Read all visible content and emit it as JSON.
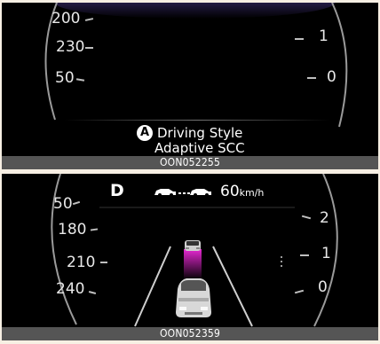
{
  "top": {
    "left_gauge_labels": [
      "200",
      "230",
      "50"
    ],
    "right_gauge_labels": [
      "1",
      "0"
    ],
    "message_letter": "A",
    "message_line1": "Driving Style",
    "message_line2": "Adaptive SCC",
    "caption": "OON052255"
  },
  "bottom": {
    "gear": "D",
    "speed_value": "60",
    "speed_unit": "km/h",
    "left_gauge_labels": [
      "50",
      "180",
      "210",
      "240"
    ],
    "right_gauge_labels": [
      "2",
      "1",
      "0"
    ],
    "caption": "OON052359"
  },
  "colors": {
    "background": "#f7efe3",
    "panel": "#000000",
    "caption_bar": "#555555",
    "lane_highlight": "#dc28c8"
  },
  "icons": [
    "car-distance-icon",
    "lead-vehicle-icon",
    "own-vehicle-icon"
  ]
}
